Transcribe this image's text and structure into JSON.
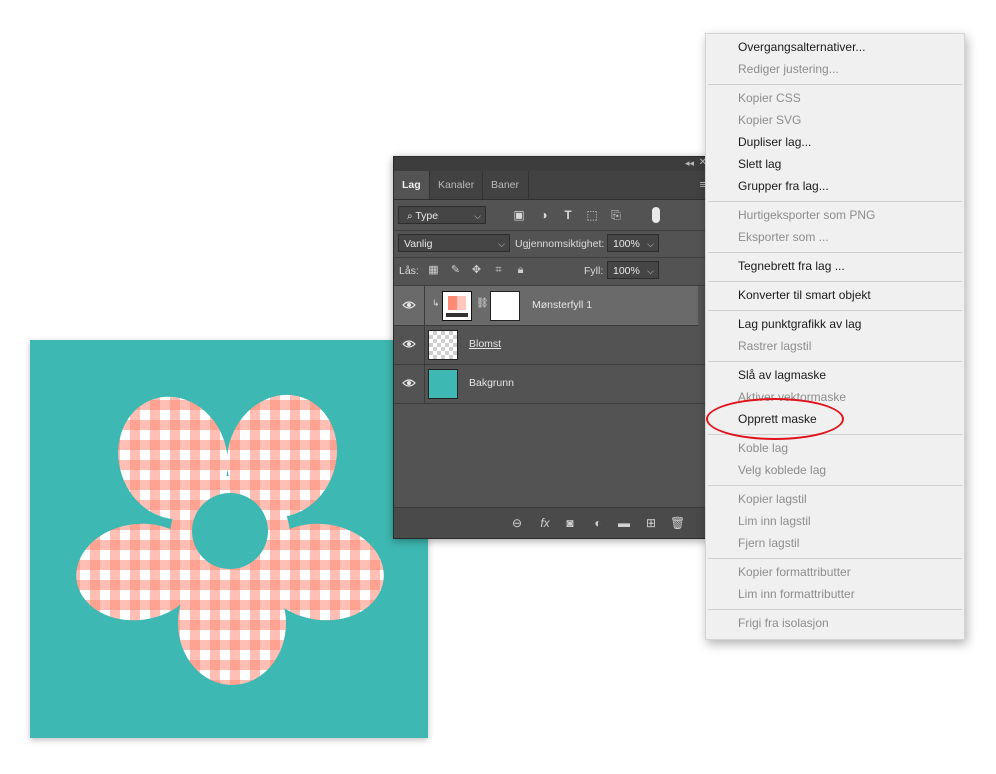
{
  "canvas": {
    "background_color": "#3eb8b2",
    "pattern_colors": [
      "#ff8a76",
      "#ffffff"
    ]
  },
  "layers_panel": {
    "tabs": [
      {
        "label": "Lag",
        "active": true
      },
      {
        "label": "Kanaler",
        "active": false
      },
      {
        "label": "Baner",
        "active": false
      }
    ],
    "filter": {
      "kind_label": "Type"
    },
    "blend_mode": "Vanlig",
    "opacity": {
      "label": "Ugjennomsiktighet:",
      "value": "100%"
    },
    "lock": {
      "label": "Lås:"
    },
    "fill": {
      "label": "Fyll:",
      "value": "100%"
    },
    "layers": [
      {
        "name": "Mønsterfyll 1",
        "visible": true,
        "selected": true
      },
      {
        "name": "Blomst",
        "visible": true,
        "selected": false
      },
      {
        "name": "Bakgrunn",
        "visible": true,
        "selected": false
      }
    ]
  },
  "context_menu": {
    "items": [
      {
        "label": "Overgangsalternativer...",
        "enabled": true
      },
      {
        "label": "Rediger justering...",
        "enabled": false
      },
      {
        "label": "Kopier CSS",
        "enabled": false
      },
      {
        "label": "Kopier SVG",
        "enabled": false
      },
      {
        "label": "Dupliser lag...",
        "enabled": true
      },
      {
        "label": "Slett lag",
        "enabled": true
      },
      {
        "label": "Grupper fra lag...",
        "enabled": true
      },
      {
        "label": "Hurtigeksporter som PNG",
        "enabled": false
      },
      {
        "label": "Eksporter som ...",
        "enabled": false
      },
      {
        "label": "Tegnebrett fra lag ...",
        "enabled": true
      },
      {
        "label": "Konverter til smart objekt",
        "enabled": true
      },
      {
        "label": "Lag punktgrafikk av lag",
        "enabled": true
      },
      {
        "label": "Rastrer lagstil",
        "enabled": false
      },
      {
        "label": "Slå av lagmaske",
        "enabled": true
      },
      {
        "label": "Aktiver vektormaske",
        "enabled": false
      },
      {
        "label": "Opprett maske",
        "enabled": true,
        "highlighted": true
      },
      {
        "label": "Koble lag",
        "enabled": false
      },
      {
        "label": "Velg koblede lag",
        "enabled": false
      },
      {
        "label": "Kopier lagstil",
        "enabled": false
      },
      {
        "label": "Lim inn lagstil",
        "enabled": false
      },
      {
        "label": "Fjern lagstil",
        "enabled": false
      },
      {
        "label": "Kopier formattributter",
        "enabled": false
      },
      {
        "label": "Lim inn formattributter",
        "enabled": false
      },
      {
        "label": "Frigi fra isolasjon",
        "enabled": false
      }
    ],
    "highlight_color": "#e0121b"
  }
}
